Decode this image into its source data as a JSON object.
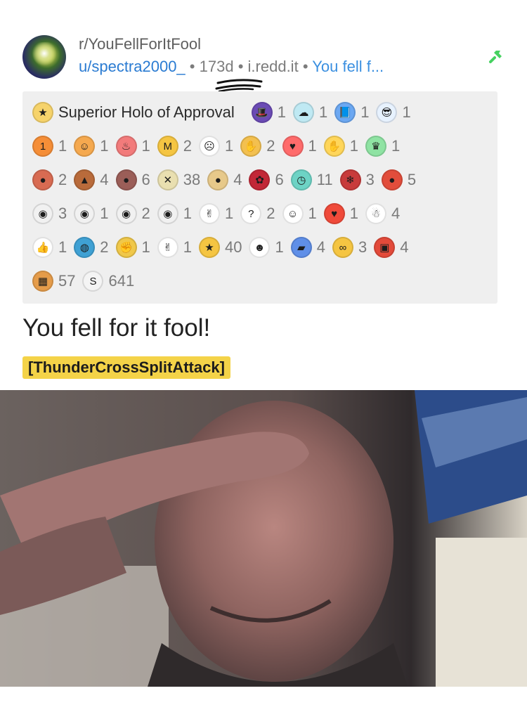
{
  "post": {
    "subreddit": "r/YouFellForItFool",
    "user": "u/spectra2000_",
    "age": "173d",
    "domain": "i.redd.it",
    "link_text": "You fell f...",
    "bullet": "•"
  },
  "awards": {
    "first_label": "Superior Holo of Approval",
    "rows": [
      [
        {
          "icon": "superior-holo-award-icon",
          "count": "",
          "color": "#f6d36b",
          "glyph": "★"
        },
        {
          "icon": "wizard-cat-award-icon",
          "count": "1",
          "color": "#6b4bb5",
          "glyph": "🎩"
        },
        {
          "icon": "cloud-award-icon",
          "count": "1",
          "color": "#bfe9f3",
          "glyph": "☁"
        },
        {
          "icon": "book-award-icon",
          "count": "1",
          "color": "#6ca8f2",
          "glyph": "📘"
        },
        {
          "icon": "cool-snoo-award-icon",
          "count": "1",
          "color": "#e7f2ff",
          "glyph": "😎"
        }
      ],
      [
        {
          "icon": "number-one-award-icon",
          "count": "1",
          "color": "#f58e37",
          "glyph": "1"
        },
        {
          "icon": "orange-smile-award-icon",
          "count": "1",
          "color": "#f5a94f",
          "glyph": "☺"
        },
        {
          "icon": "chef-award-icon",
          "count": "1",
          "color": "#f27b7b",
          "glyph": "♨"
        },
        {
          "icon": "m-badge-award-icon",
          "count": "2",
          "color": "#f5c542",
          "glyph": "M"
        },
        {
          "icon": "surprised-award-icon",
          "count": "1",
          "color": "#ffffff",
          "glyph": "☹"
        },
        {
          "icon": "handshake-award-icon",
          "count": "2",
          "color": "#f3c04f",
          "glyph": "✋"
        },
        {
          "icon": "heart-eyes-award-icon",
          "count": "1",
          "color": "#ff6b6b",
          "glyph": "♥"
        },
        {
          "icon": "clap-award-icon",
          "count": "1",
          "color": "#ffd65a",
          "glyph": "✋"
        },
        {
          "icon": "crown-award-icon",
          "count": "1",
          "color": "#8fe3a3",
          "glyph": "♛"
        }
      ],
      [
        {
          "icon": "red-hair-award-icon",
          "count": "2",
          "color": "#d86b52",
          "glyph": "●"
        },
        {
          "icon": "fox-award-icon",
          "count": "4",
          "color": "#b96b3b",
          "glyph": "▲"
        },
        {
          "icon": "horned-award-icon",
          "count": "6",
          "color": "#9b5e58",
          "glyph": "●"
        },
        {
          "icon": "crossed-swords-award-icon",
          "count": "38",
          "color": "#e9dfb0",
          "glyph": "✕"
        },
        {
          "icon": "blonde-award-icon",
          "count": "4",
          "color": "#e7c98a",
          "glyph": "●"
        },
        {
          "icon": "rose-award-icon",
          "count": "6",
          "color": "#c22737",
          "glyph": "✿"
        },
        {
          "icon": "timer-award-icon",
          "count": "11",
          "color": "#6dd3c5",
          "glyph": "◷"
        },
        {
          "icon": "sleigh-award-icon",
          "count": "3",
          "color": "#c83b3b",
          "glyph": "❄"
        },
        {
          "icon": "santa-snoo-award-icon",
          "count": "5",
          "color": "#e24d3b",
          "glyph": "●"
        }
      ],
      [
        {
          "icon": "snoo-award-icon",
          "count": "3",
          "color": "#f1f1f1",
          "glyph": "◉"
        },
        {
          "icon": "snoo-award-icon",
          "count": "1",
          "color": "#f1f1f1",
          "glyph": "◉"
        },
        {
          "icon": "snoo-award-icon",
          "count": "2",
          "color": "#f1f1f1",
          "glyph": "◉"
        },
        {
          "icon": "snoo-award-icon",
          "count": "1",
          "color": "#f1f1f1",
          "glyph": "◉"
        },
        {
          "icon": "ok-hand-award-icon",
          "count": "1",
          "color": "#ffffff",
          "glyph": "✌"
        },
        {
          "icon": "thinking-award-icon",
          "count": "2",
          "color": "#ffffff",
          "glyph": "?"
        },
        {
          "icon": "wink-award-icon",
          "count": "1",
          "color": "#ffffff",
          "glyph": "☺"
        },
        {
          "icon": "fire-heart-award-icon",
          "count": "1",
          "color": "#f04a3a",
          "glyph": "♥"
        },
        {
          "icon": "santa-award-icon",
          "count": "4",
          "color": "#ffffff",
          "glyph": "☃"
        }
      ],
      [
        {
          "icon": "thumbs-up-fire-award-icon",
          "count": "1",
          "color": "#ffffff",
          "glyph": "👍"
        },
        {
          "icon": "globe-award-icon",
          "count": "2",
          "color": "#3fa1d4",
          "glyph": "◍"
        },
        {
          "icon": "fist-award-icon",
          "count": "1",
          "color": "#f0c84a",
          "glyph": "✊"
        },
        {
          "icon": "bunny-ears-award-icon",
          "count": "1",
          "color": "#ffffff",
          "glyph": "✌"
        },
        {
          "icon": "gold-star-award-icon",
          "count": "40",
          "color": "#f5c542",
          "glyph": "★"
        },
        {
          "icon": "happy-face-award-icon",
          "count": "1",
          "color": "#ffffff",
          "glyph": "☻"
        },
        {
          "icon": "car-snoo-award-icon",
          "count": "4",
          "color": "#5f8fe8",
          "glyph": "▰"
        },
        {
          "icon": "2020-glasses-award-icon",
          "count": "3",
          "color": "#f5c542",
          "glyph": "∞"
        },
        {
          "icon": "gift-award-icon",
          "count": "4",
          "color": "#e34a3a",
          "glyph": "▣"
        }
      ],
      [
        {
          "icon": "treasure-award-icon",
          "count": "57",
          "color": "#e59c4a",
          "glyph": "▦"
        },
        {
          "icon": "silver-coin-award-icon",
          "count": "641",
          "color": "#f4f4f4",
          "glyph": "S"
        }
      ]
    ]
  },
  "title": "You fell for it fool!",
  "flair": "[ThunderCrossSplitAttack]",
  "image": {
    "description_icon": "salute-photo"
  },
  "colors": {
    "link_blue": "#3a8fe0",
    "flair_yellow": "#f4d348",
    "pin_green": "#46d160"
  }
}
